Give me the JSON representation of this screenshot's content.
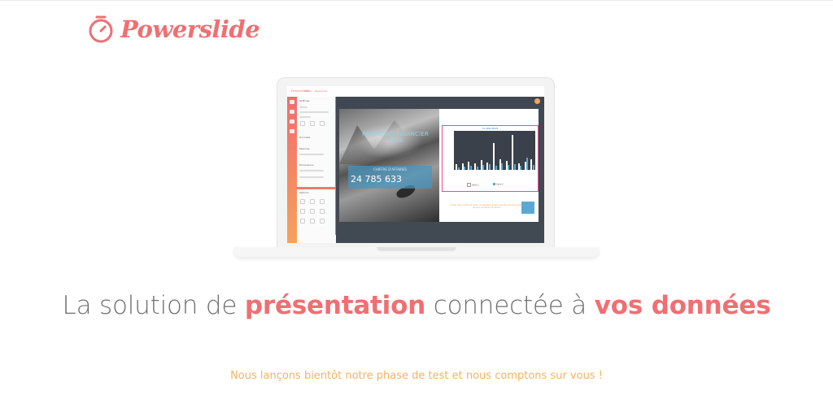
{
  "logo": {
    "text": "Powerslide"
  },
  "laptop": {
    "app": {
      "logo": "Powerslide",
      "nav": [
        "Pulse",
        "Resources"
      ],
      "panel": {
        "title": "Settings",
        "sections": [
          "Données",
          "Mesures",
          "Dimensions",
          "Options"
        ]
      },
      "slide": {
        "title_line1": "RÉSULTATS FINANCIER",
        "title_line2": "2018",
        "kpi_label": "CHIFFRE D'AFFAIRES",
        "kpi_value": "24 785 633",
        "chart_title": "CA PAR MOIS",
        "legend": [
          "Série 1",
          "Série 2"
        ],
        "note": "Lorem ipsum dolor sit amet, consectetur adipiscing elit sed do eiusmod tempor incididunt ut labore"
      }
    }
  },
  "headline": {
    "part1": "La solution de ",
    "highlight1": "présentation",
    "part2": " connectée à ",
    "highlight2": "vos données"
  },
  "subtitle": "Nous lançons bientôt notre phase de test et nous comptons sur vous !",
  "colors": {
    "brand": "#ef6f73",
    "accent": "#f5b45a",
    "text": "#707070"
  },
  "chart_data": {
    "type": "bar",
    "series": [
      {
        "name": "Série 1",
        "values": [
          8,
          10,
          12,
          9,
          14,
          11,
          40,
          16,
          13,
          52,
          10,
          12,
          15
        ]
      },
      {
        "name": "Série 2",
        "values": [
          4,
          5,
          6,
          5,
          7,
          8,
          6,
          9,
          7,
          8,
          6,
          18,
          7
        ]
      }
    ],
    "ylim": [
      0,
      55
    ]
  }
}
